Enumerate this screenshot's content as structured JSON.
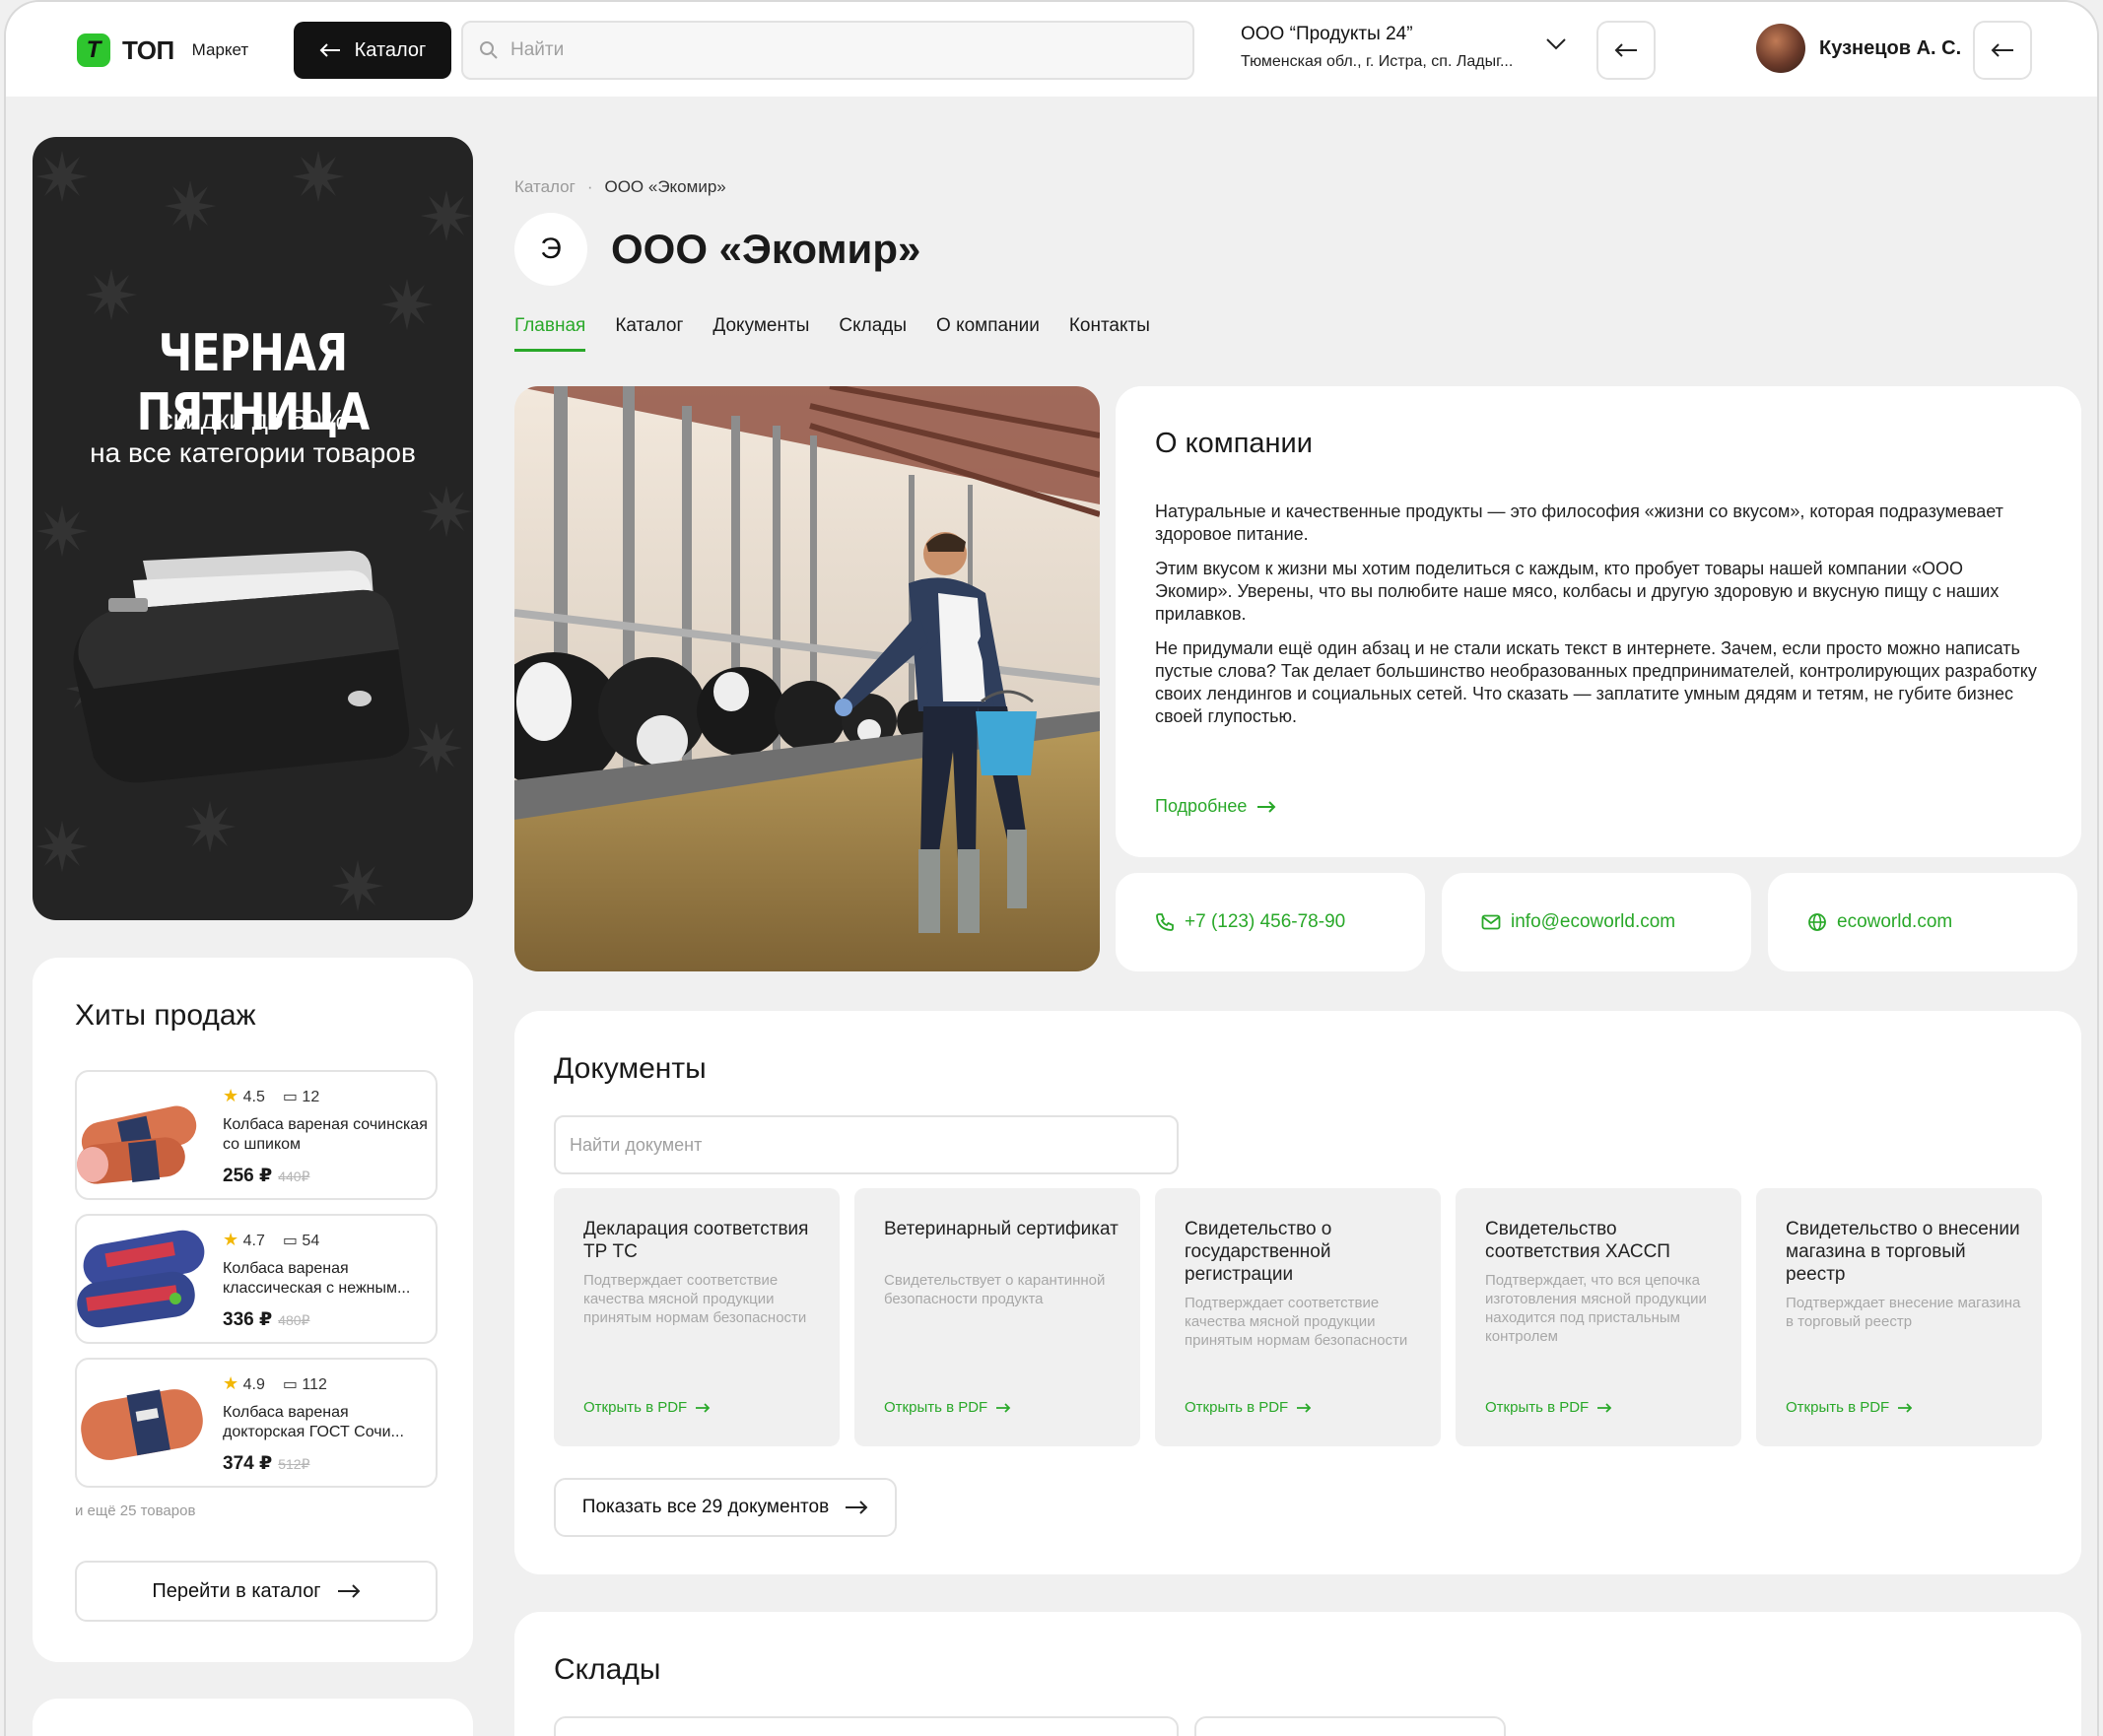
{
  "header": {
    "logo_text": "ТОП",
    "logo_sub": "Маркет",
    "catalog_label": "Каталог",
    "search_placeholder": "Найти",
    "org_name": "ООО “Продукты 24”",
    "org_address": "Тюменская обл., г. Истра, сп. Ладыг...",
    "user_name": "Кузнецов А. С."
  },
  "promo": {
    "title": "ЧЕРНАЯ ПЯТНИЦА",
    "line1": "скидки до 50%",
    "line2": "на все категории товаров"
  },
  "hits": {
    "title": "Хиты продаж",
    "products": [
      {
        "rating": "4.5",
        "reviews": "12",
        "name": "Колбаса вареная сочинская со шпиком",
        "price": "256 ₽",
        "old_price": "440₽"
      },
      {
        "rating": "4.7",
        "reviews": "54",
        "name": "Колбаса вареная классическая с нежным...",
        "price": "336 ₽",
        "old_price": "480₽"
      },
      {
        "rating": "4.9",
        "reviews": "112",
        "name": "Колбаса вареная докторская ГОСТ Сочи...",
        "price": "374 ₽",
        "old_price": "512₽"
      }
    ],
    "more_note": "и ещё 25 товаров",
    "goto_label": "Перейти в каталог"
  },
  "breadcrumb": {
    "root": "Каталог",
    "separator": "·",
    "current": "ООО «Экомир»"
  },
  "company": {
    "logo_letter": "Э",
    "title": "ООО «Экомир»"
  },
  "tabs": [
    "Главная",
    "Каталог",
    "Документы",
    "Склады",
    "О компании",
    "Контакты"
  ],
  "about": {
    "title": "О компании",
    "p1": "Натуральные и качественные продукты — это философия «жизни со вкусом», которая подразумевает здоровое питание.",
    "p2": "Этим вкусом к жизни мы хотим поделиться с каждым, кто пробует товары нашей компании «ООО Экомир». Уверены, что вы полюбите наше мясо, колбасы и другую здоровую и вкусную пищу с наших прилавков.",
    "p3": "Не придумали ещё один абзац и не стали искать текст в интернете. Зачем, если просто можно написать пустые слова? Так делает большинство необразованных предпринимателей, контролирующих разработку своих лендингов и социальных сетей. Что сказать — заплатите умным дядям и тетям, не губите бизнес своей глупостью.",
    "more_label": "Подробнее"
  },
  "contacts": {
    "phone": "+7 (123) 456-78-90",
    "email": "info@ecoworld.com",
    "site": "ecoworld.com"
  },
  "documents": {
    "title": "Документы",
    "search_placeholder": "Найти документ",
    "items": [
      {
        "title": "Декларация соответствия ТР ТС",
        "desc": "Подтверждает соответствие качества мясной продукции принятым нормам безопасности",
        "link": "Открыть в PDF"
      },
      {
        "title": "Ветеринарный сертификат",
        "desc": "Свидетельствует о карантинной безопасности продукта",
        "link": "Открыть в PDF"
      },
      {
        "title": "Свидетельство о государственной регистрации",
        "desc": "Подтверждает соответствие качества мясной продукции принятым нормам безопасности",
        "link": "Открыть в PDF"
      },
      {
        "title": "Свидетельство соответствия ХАССП",
        "desc": "Подтверждает, что вся цепочка изготовления мясной продукции находится под пристальным контролем",
        "link": "Открыть в PDF"
      },
      {
        "title": "Свидетельство о внесении магазина в торговый реестр",
        "desc": "Подтверждает внесение магазина в торговый реестр",
        "link": "Открыть в PDF"
      }
    ],
    "show_all_label": "Показать все 29 документов"
  },
  "stores": {
    "title": "Склады"
  },
  "colors": {
    "accent": "#29a829",
    "logo_green": "#2ec52e",
    "dark_button": "#121212",
    "page_bg": "#f0f0f0",
    "star": "#f2b705"
  },
  "icons": [
    "search-icon",
    "arrow-left-icon",
    "chevron-down-icon",
    "phone-icon",
    "mail-icon",
    "globe-icon",
    "star-icon",
    "comment-icon",
    "arrow-right-icon"
  ]
}
